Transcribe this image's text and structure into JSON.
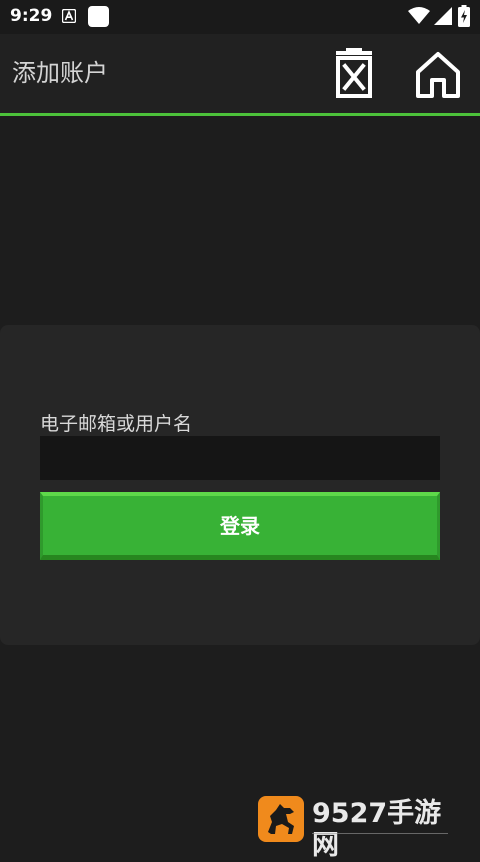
{
  "status_bar": {
    "time": "9:29",
    "icons": [
      "a-notification-icon",
      "app-square-icon",
      "wifi-icon",
      "cell-signal-icon",
      "battery-charging-icon"
    ]
  },
  "app_bar": {
    "title": "添加账户",
    "actions": [
      "delete-icon",
      "home-icon"
    ],
    "divider_color": "#4cc23a"
  },
  "login_form": {
    "field_label": "电子邮箱或用户名",
    "field_value": "",
    "login_label": "登录",
    "button_color": "#38b236"
  },
  "watermark": {
    "text": "9527手游网",
    "logo": "horse-logo-icon"
  }
}
